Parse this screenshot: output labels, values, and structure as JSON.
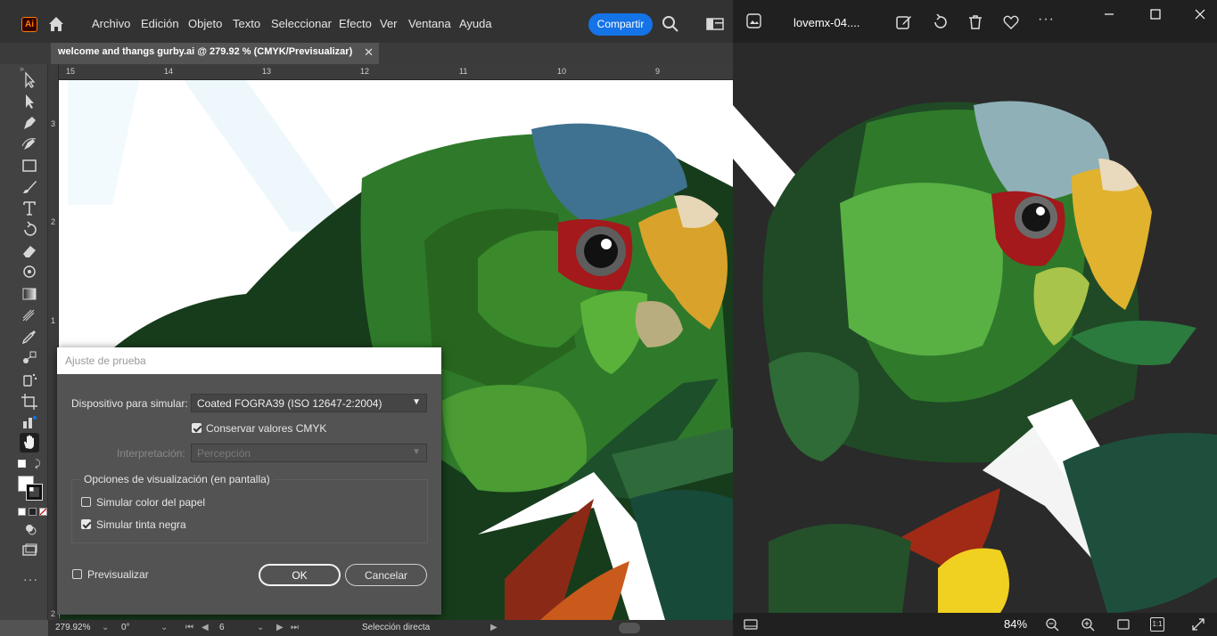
{
  "illustrator": {
    "app_icon": "Ai",
    "menu": [
      "Archivo",
      "Edición",
      "Objeto",
      "Texto",
      "Seleccionar",
      "Efecto",
      "Ver",
      "Ventana",
      "Ayuda"
    ],
    "share_label": "Compartir",
    "document_tab": "welcome and thangs gurby.ai @ 279.92 % (CMYK/Previsualizar)",
    "ruler_top": [
      "15",
      "14",
      "13",
      "12",
      "11",
      "10",
      "9"
    ],
    "ruler_left": [
      "3",
      "2",
      "1",
      "2"
    ],
    "status": {
      "zoom": "279.92%",
      "rotation": "0°",
      "artboard": "6",
      "tool": "Selección directa"
    }
  },
  "dialog": {
    "title": "Ajuste de prueba",
    "device_label": "Dispositivo para simular:",
    "device_value": "Coated FOGRA39 (ISO 12647-2:2004)",
    "preserve_cmyk_label": "Conservar valores CMYK",
    "preserve_cmyk_checked": true,
    "intent_label": "Interpretación:",
    "intent_value": "Percepción",
    "display_options_label": "Opciones de visualización (en pantalla)",
    "sim_paper_label": "Simular color del papel",
    "sim_paper_checked": false,
    "sim_ink_label": "Simular tinta negra",
    "sim_ink_checked": true,
    "preview_label": "Previsualizar",
    "preview_checked": false,
    "ok_label": "OK",
    "cancel_label": "Cancelar"
  },
  "photos": {
    "filename": "lovemx-04....",
    "zoom": "84%",
    "actual_size": "1:1"
  },
  "colors": {
    "ai_menubar": "#323232",
    "ai_workspace": "#535353",
    "share_blue": "#1473e6",
    "ai_orange": "#ff7c00",
    "photos_bg": "#202020"
  }
}
